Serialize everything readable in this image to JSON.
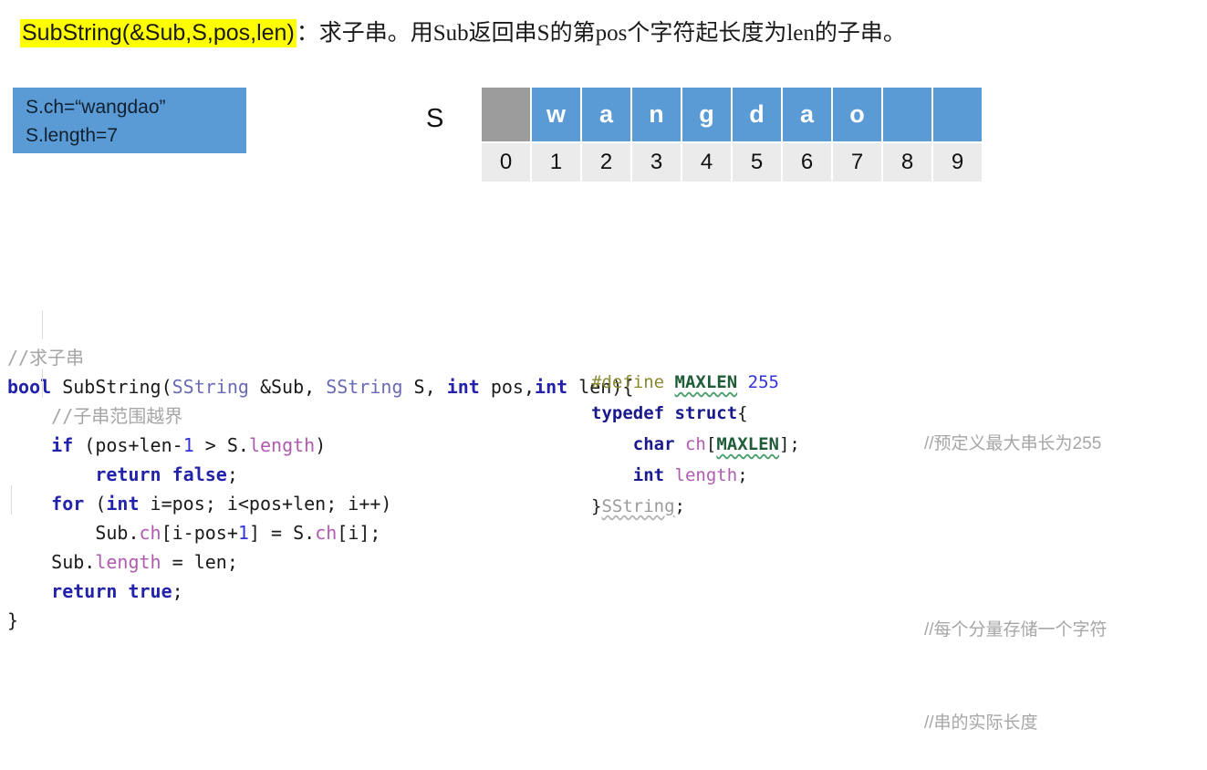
{
  "title": {
    "highlighted": "SubString(&Sub,S,pos,len)",
    "rest": "：求子串。用Sub返回串S的第pos个字符起长度为len的子串。",
    "highlight_color": "#ffff00"
  },
  "info_box": {
    "line1": "S.ch=“wangdao”",
    "line2": "S.length=7",
    "background": "#5b9bd5"
  },
  "string_table": {
    "label": "S",
    "colors": {
      "empty_first": "#9c9c9c",
      "filled": "#5b9bd5",
      "index_row": "#ebebeb"
    },
    "cells": [
      {
        "char": "",
        "index": "0",
        "state": "gray"
      },
      {
        "char": "w",
        "index": "1",
        "state": "blue"
      },
      {
        "char": "a",
        "index": "2",
        "state": "blue"
      },
      {
        "char": "n",
        "index": "3",
        "state": "blue"
      },
      {
        "char": "g",
        "index": "4",
        "state": "blue"
      },
      {
        "char": "d",
        "index": "5",
        "state": "blue"
      },
      {
        "char": "a",
        "index": "6",
        "state": "blue"
      },
      {
        "char": "o",
        "index": "7",
        "state": "blue"
      },
      {
        "char": "",
        "index": "8",
        "state": "blue"
      },
      {
        "char": "",
        "index": "9",
        "state": "blue"
      }
    ]
  },
  "code_left": {
    "lines": [
      "//求子串",
      "bool SubString(SString &Sub, SString S, int pos,int len){",
      "    //子串范围越界",
      "    if (pos+len-1 > S.length)",
      "        return false;",
      "    for (int i=pos; i<pos+len; i++)",
      "        Sub.ch[i-pos+1] = S.ch[i];",
      "    Sub.length = len;",
      "    return true;",
      "}"
    ]
  },
  "code_right": {
    "lines": [
      "#define MAXLEN 255",
      "typedef struct{",
      "    char ch[MAXLEN];",
      "    int length;",
      "}SString;"
    ]
  },
  "comments_right": {
    "define_comment": "//预定义最大串长为255",
    "ch_comment": "//每个分量存储一个字符",
    "length_comment": "//串的实际长度"
  }
}
